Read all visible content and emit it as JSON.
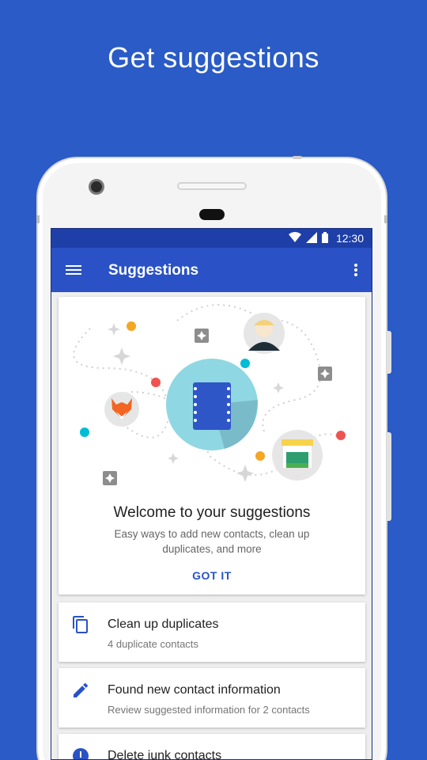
{
  "headline": "Get suggestions",
  "status": {
    "time": "12:30"
  },
  "appbar": {
    "title": "Suggestions",
    "menu_icon": "menu-icon",
    "more_icon": "more-vert-icon"
  },
  "welcome": {
    "title": "Welcome to your suggestions",
    "subtitle": "Easy ways to add new contacts, clean up duplicates, and more",
    "action": "GOT IT"
  },
  "suggestions": [
    {
      "icon": "copy-icon",
      "title": "Clean up duplicates",
      "subtitle": "4 duplicate contacts"
    },
    {
      "icon": "edit-icon",
      "title": "Found new contact information",
      "subtitle": "Review suggested information for 2 contacts"
    },
    {
      "icon": "alert-icon",
      "title": "Delete junk contacts",
      "subtitle": ""
    }
  ],
  "colors": {
    "background": "#2a5bc6",
    "appbar": "#2a52c6",
    "statusbar": "#1e3fa8",
    "accent": "#2a52c6"
  }
}
